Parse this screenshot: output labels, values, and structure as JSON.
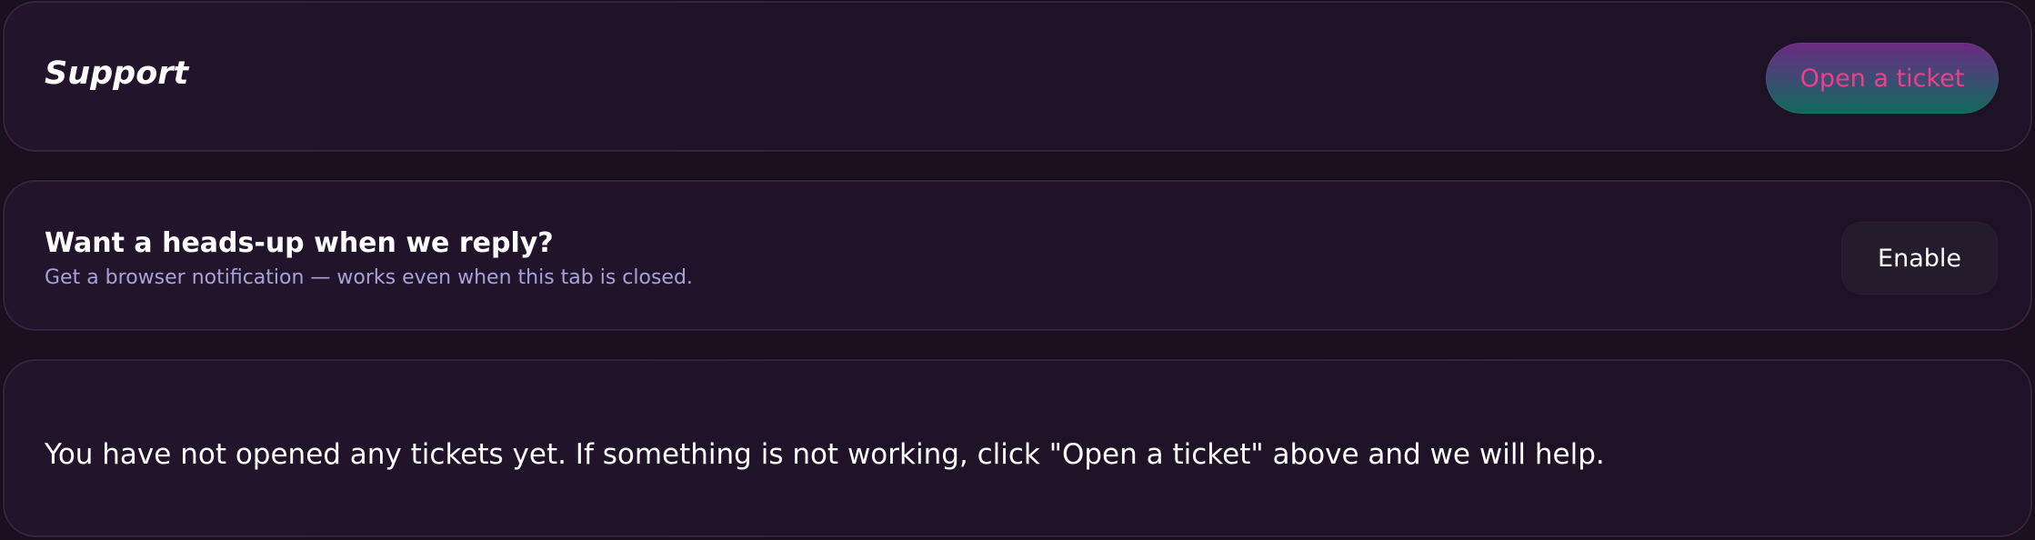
{
  "support": {
    "title": "Support",
    "open_ticket_label": "Open a ticket"
  },
  "notifications": {
    "title": "Want a heads-up when we reply?",
    "subtitle": "Get a browser notification — works even when this tab is closed.",
    "enable_label": "Enable"
  },
  "tickets": {
    "empty_message": "You have not opened any tickets yet. If something is not working, click \"Open a ticket\" above and we will help."
  },
  "colors": {
    "background": "#1a1020",
    "card_border": "#3a2140",
    "accent_pink": "#f03e8c",
    "subtitle_lavender": "#a7a3d8"
  }
}
